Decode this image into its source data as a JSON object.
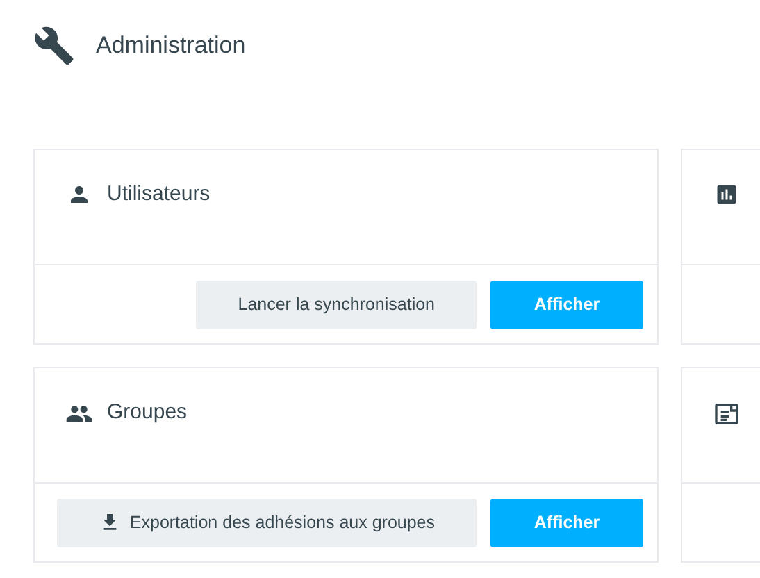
{
  "header": {
    "title": "Administration"
  },
  "cards": [
    {
      "kind": "full",
      "title": "Utilisateurs",
      "buttons": [
        {
          "kind": "action",
          "label": "Lancer la synchronisation"
        },
        {
          "kind": "primary",
          "label": "Afficher"
        }
      ]
    },
    {
      "kind": "clipped"
    },
    {
      "kind": "full",
      "title": "Groupes",
      "buttons": [
        {
          "kind": "download",
          "label": "Exportation des adhésions aux groupes"
        },
        {
          "kind": "primary",
          "label": "Afficher"
        }
      ]
    },
    {
      "kind": "clipped"
    }
  ]
}
